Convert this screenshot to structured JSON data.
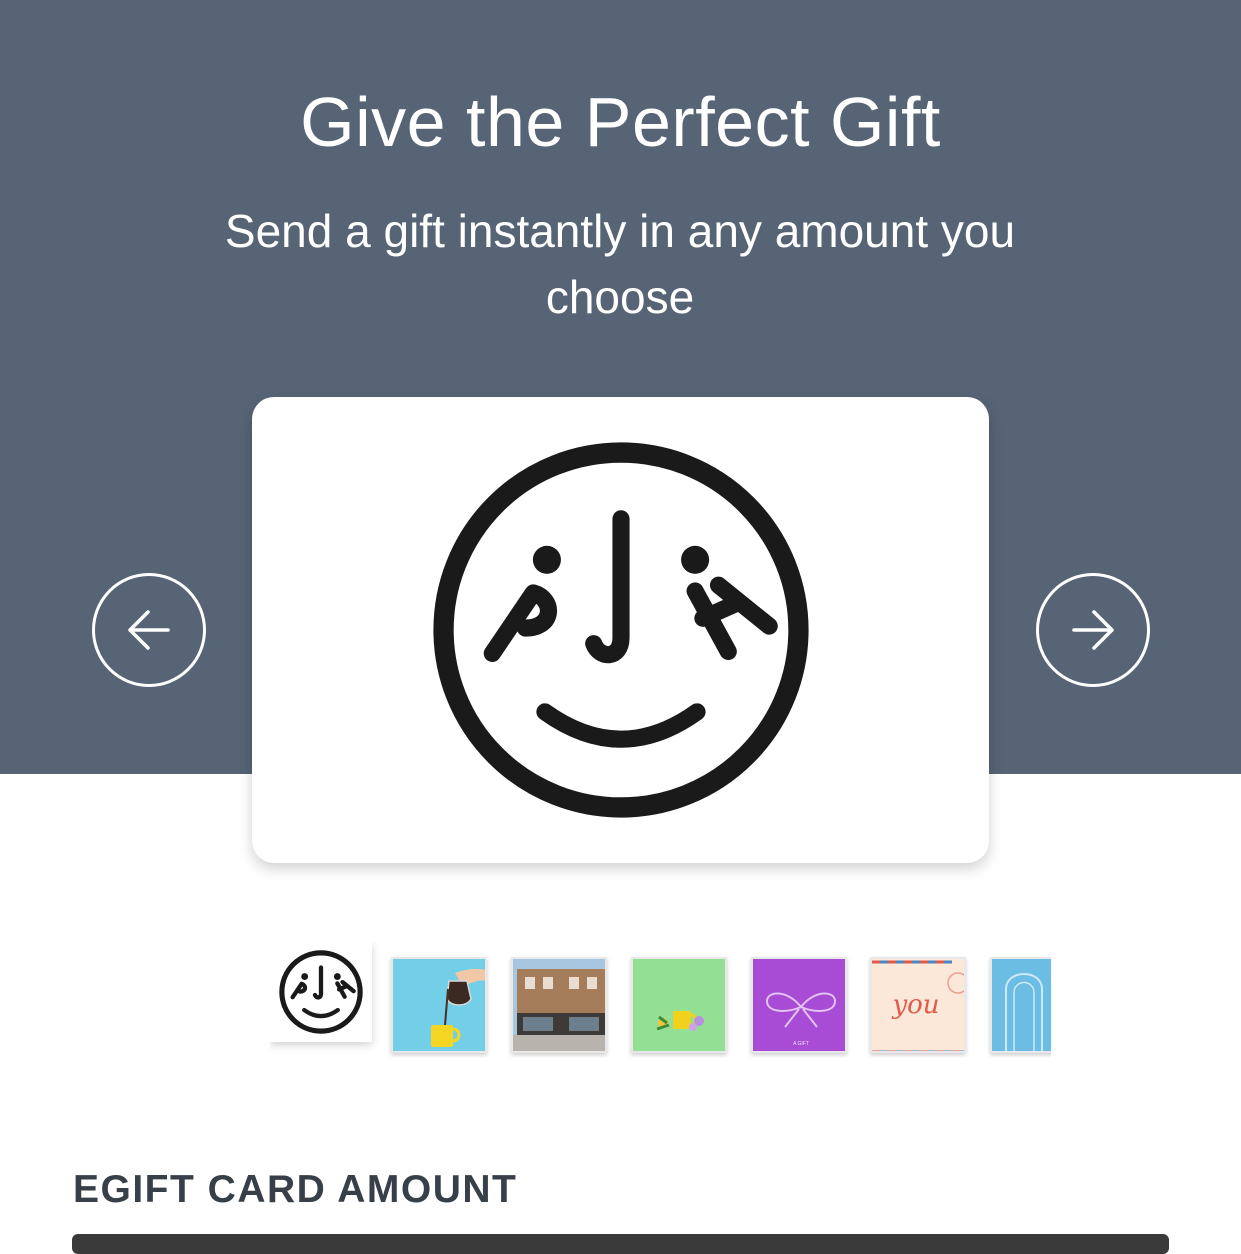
{
  "hero": {
    "title": "Give the Perfect Gift",
    "subtitle": "Send a gift instantly in any amount you choose",
    "background_color": "#566476"
  },
  "card": {
    "logo_letters": "PJH",
    "logo_icon": "smiley-logo"
  },
  "carousel": {
    "prev_icon": "arrow-left-icon",
    "next_icon": "arrow-right-icon"
  },
  "thumbnails": [
    {
      "name": "logo-design",
      "selected": true
    },
    {
      "name": "coffee-pour-design",
      "selected": false
    },
    {
      "name": "storefront-design",
      "selected": false
    },
    {
      "name": "mug-flowers-design",
      "selected": false
    },
    {
      "name": "bow-gift-design",
      "selected": false,
      "caption": "A GIFT"
    },
    {
      "name": "airmail-you-design",
      "selected": false,
      "caption": "you"
    },
    {
      "name": "door-design",
      "selected": false
    }
  ],
  "amount_section": {
    "label": "EGIFT CARD AMOUNT"
  }
}
